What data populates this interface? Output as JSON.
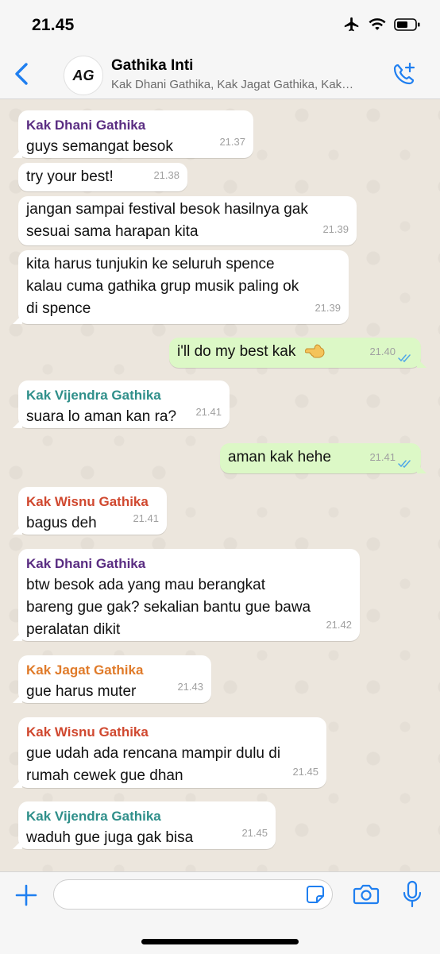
{
  "status_bar": {
    "time": "21.45"
  },
  "header": {
    "avatar_text": "AG",
    "title": "Gathika Inti",
    "subtitle": "Kak Dhani Gathika, Kak Jagat Gathika, Kak…"
  },
  "colors": {
    "accent": "#1f7ff0",
    "dhani": "#5a2d82",
    "vijendra": "#2f8f8a",
    "wisnu": "#d0482f",
    "jagat": "#e07b2a",
    "outgoing_bubble": "#dcf8c6",
    "read_ticks": "#4fa6e8"
  },
  "messages": [
    {
      "sender": "Kak Dhani Gathika",
      "lines": [
        "guys semangat besok"
      ],
      "time": "21.37",
      "direction": "in"
    },
    {
      "sender": "",
      "lines": [
        "try your best!"
      ],
      "time": "21.38",
      "direction": "in"
    },
    {
      "sender": "",
      "lines": [
        "jangan sampai festival besok hasilnya gak",
        "sesuai sama harapan kita"
      ],
      "time": "21.39",
      "direction": "in"
    },
    {
      "sender": "",
      "lines": [
        "kita harus tunjukin ke seluruh spence",
        "kalau cuma gathika grup musik paling ok",
        "di spence"
      ],
      "time": "21.39",
      "direction": "in"
    },
    {
      "sender": "",
      "lines": [
        "i'll do my best kak"
      ],
      "time": "21.40",
      "direction": "out",
      "emoji": "pointing-hand-emoji"
    },
    {
      "sender": "Kak Vijendra Gathika",
      "lines": [
        "suara lo aman kan ra?"
      ],
      "time": "21.41",
      "direction": "in"
    },
    {
      "sender": "",
      "lines": [
        "aman kak hehe"
      ],
      "time": "21.41",
      "direction": "out"
    },
    {
      "sender": "Kak Wisnu Gathika",
      "lines": [
        "bagus deh"
      ],
      "time": "21.41",
      "direction": "in"
    },
    {
      "sender": "Kak Dhani Gathika",
      "lines": [
        "btw besok ada yang mau berangkat",
        "bareng gue gak? sekalian bantu gue bawa",
        "peralatan dikit"
      ],
      "time": "21.42",
      "direction": "in"
    },
    {
      "sender": "Kak Jagat Gathika",
      "lines": [
        "gue harus muter"
      ],
      "time": "21.43",
      "direction": "in"
    },
    {
      "sender": "Kak Wisnu Gathika",
      "lines": [
        "gue udah ada rencana mampir dulu di",
        "rumah cewek gue dhan"
      ],
      "time": "21.45",
      "direction": "in"
    },
    {
      "sender": "Kak Vijendra Gathika",
      "lines": [
        "waduh gue juga gak bisa"
      ],
      "time": "21.45",
      "direction": "in"
    }
  ],
  "input": {
    "value": "",
    "placeholder": ""
  },
  "icons": {
    "back": "chevron-left-icon",
    "call": "add-call-icon",
    "plus": "plus-icon",
    "sticker": "sticker-icon",
    "camera": "camera-icon",
    "mic": "microphone-icon"
  }
}
